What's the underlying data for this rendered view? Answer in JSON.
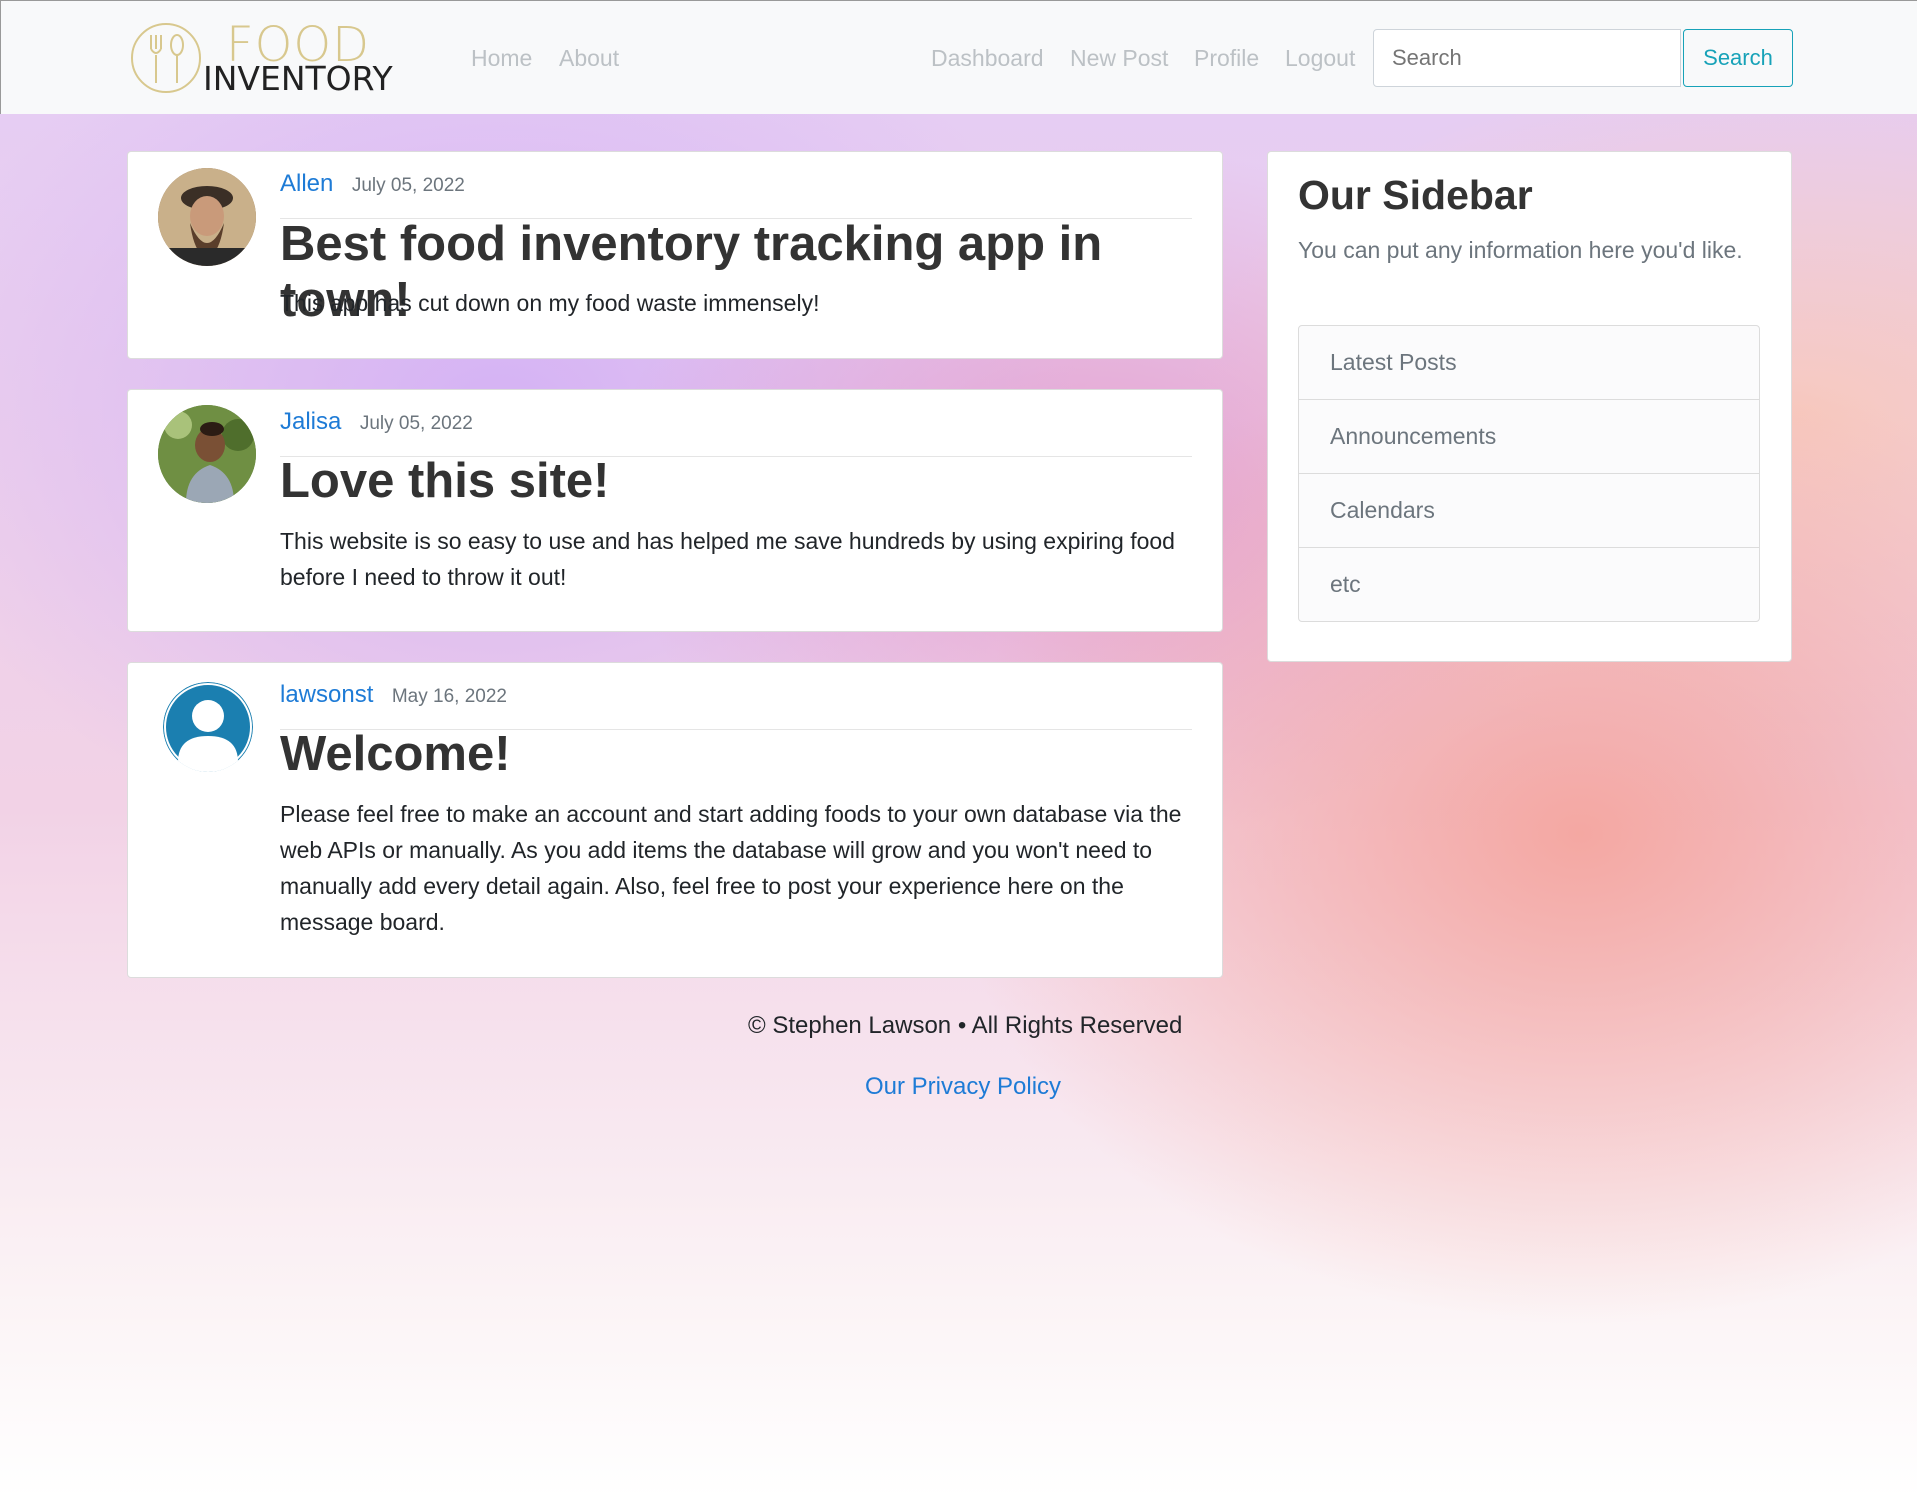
{
  "brand": {
    "line1": "FOOD",
    "line2": "INVENTORY"
  },
  "nav": {
    "home": "Home",
    "about": "About",
    "dashboard": "Dashboard",
    "new_post": "New Post",
    "profile": "Profile",
    "logout": "Logout"
  },
  "search": {
    "placeholder": "Search",
    "button": "Search"
  },
  "posts": [
    {
      "author": "Allen",
      "date": "July 05, 2022",
      "title": "Best food inventory tracking app in town!",
      "body": "This app has cut down on my food waste immensely!"
    },
    {
      "author": "Jalisa",
      "date": "July 05, 2022",
      "title": "Love this site!",
      "body": "This website is so easy to use and has helped me save hundreds by using expiring food before I need to throw it out!"
    },
    {
      "author": "lawsonst",
      "date": "May 16, 2022",
      "title": "Welcome!",
      "body": "Please feel free to make an account and start adding foods to your own database via the web APIs or manually. As you add items the database will grow and you won't need to manually add every detail again. Also, feel free to post your experience here on the message board."
    }
  ],
  "sidebar": {
    "title": "Our Sidebar",
    "description": "You can put any information here you'd like.",
    "items": [
      {
        "label": "Latest Posts"
      },
      {
        "label": "Announcements"
      },
      {
        "label": "Calendars"
      },
      {
        "label": "etc"
      }
    ]
  },
  "footer": {
    "copyright": "© Stephen Lawson • All Rights Reserved",
    "privacy": "Our Privacy Policy"
  },
  "colors": {
    "link": "#1e7bd6",
    "accent": "#17a2b8",
    "logo_gold": "#d8c88e"
  }
}
